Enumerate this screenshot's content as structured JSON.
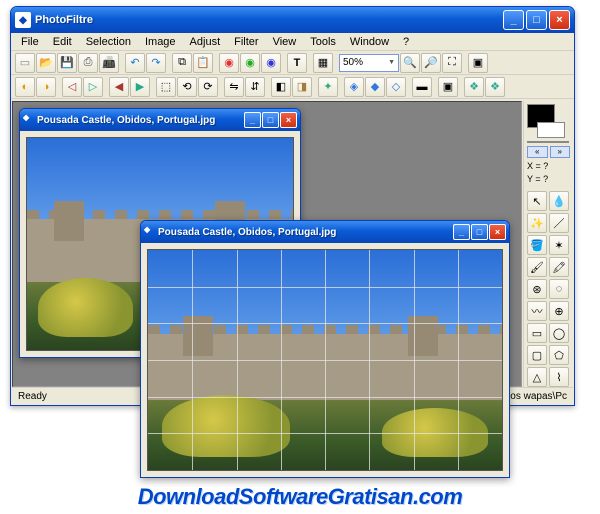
{
  "app": {
    "title": "PhotoFiltre",
    "icon_name": "photofiltre"
  },
  "menubar": {
    "items": [
      "File",
      "Edit",
      "Selection",
      "Image",
      "Adjust",
      "Filter",
      "View",
      "Tools",
      "Window",
      "?"
    ]
  },
  "toolbar": {
    "zoom_value": "50%",
    "row1_icons": [
      "new",
      "open",
      "save",
      "print",
      "scan",
      "sep",
      "undo",
      "redo",
      "sep",
      "copy",
      "paste",
      "sep",
      "rgb",
      "rgb",
      "rgb",
      "sep",
      "text",
      "sep",
      "layers",
      "sep",
      "zoom-combo",
      "sep",
      "zoom-out",
      "zoom-in",
      "zoom-fit",
      "sep",
      "fullscreen"
    ],
    "row2_icons": [
      "auto",
      "gamma-m",
      "gamma-p",
      "sep",
      "contrast-m",
      "contrast-p",
      "sep",
      "bright-m",
      "bright-p",
      "sep",
      "crop",
      "rotate-l",
      "rotate-r",
      "sep",
      "flip-h",
      "flip-v",
      "sep",
      "gray",
      "sepia",
      "sep",
      "dust",
      "sep",
      "soften",
      "sharpen",
      "blur",
      "sep",
      "gradient",
      "sep",
      "relief",
      "sep",
      "plugin1",
      "plugin2"
    ]
  },
  "side": {
    "coord_x_label": "X =",
    "coord_y_label": "Y =",
    "coord_x": "?",
    "coord_y": "?",
    "arrow_left": "«",
    "arrow_right": "»",
    "tool_icons": [
      "pointer",
      "pipette",
      "wand",
      "line",
      "fill",
      "spray",
      "brush",
      "brush2",
      "stamp",
      "blur2",
      "smudge",
      "clone",
      "rect",
      "ellipse",
      "roundrect",
      "poly",
      "triangle",
      "lasso"
    ]
  },
  "status": {
    "left": "Ready",
    "right": "os wapas\\Pc"
  },
  "child_windows": {
    "original": {
      "title": "Pousada Castle, Obidos, Portugal.jpg"
    },
    "puzzle": {
      "title": "Pousada Castle, Obidos, Portugal.jpg",
      "puzzle_cols": 8,
      "puzzle_rows": 6
    }
  },
  "watermark": "DownloadSoftwareGratisan.com"
}
